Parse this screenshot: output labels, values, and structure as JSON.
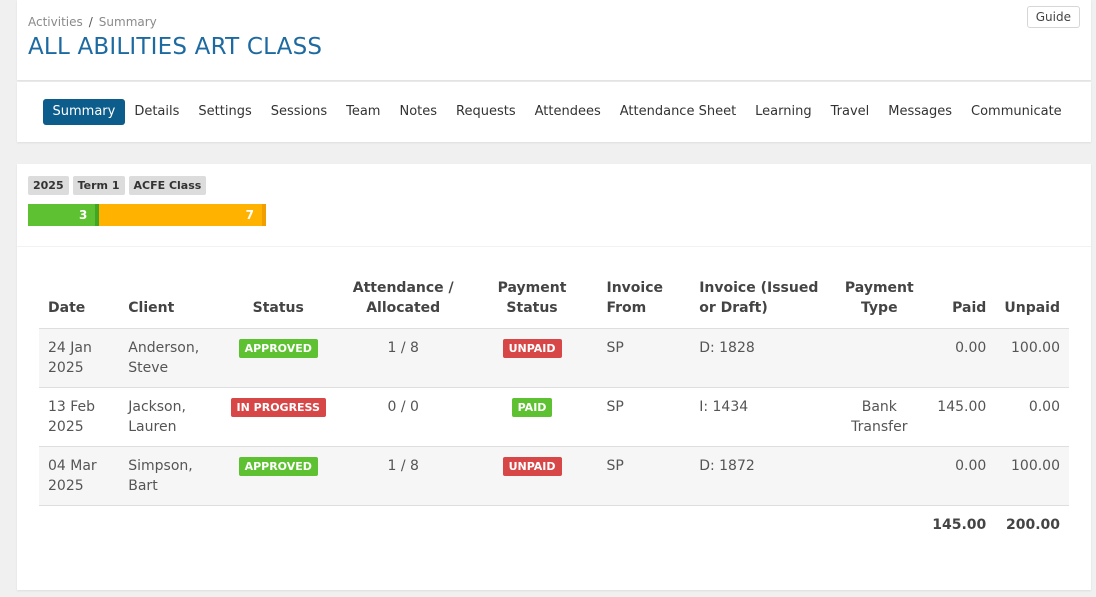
{
  "breadcrumb": {
    "parent": "Activities",
    "separator": "/",
    "current": "Summary"
  },
  "title": "ALL ABILITIES ART CLASS",
  "guide_label": "Guide",
  "tabs": [
    "Summary",
    "Details",
    "Settings",
    "Sessions",
    "Team",
    "Notes",
    "Requests",
    "Attendees",
    "Attendance Sheet",
    "Learning",
    "Travel",
    "Messages",
    "Communicate"
  ],
  "active_tab": "Summary",
  "chips": [
    "2025",
    "Term 1",
    "ACFE Class"
  ],
  "progress": {
    "approved": 3,
    "in_progress": 7
  },
  "colors": {
    "accent": "#0c5c8c",
    "title": "#1d6aa1",
    "green": "#5ec132",
    "orange": "#ffb300",
    "red": "#d84747"
  },
  "table": {
    "headers": {
      "date": "Date",
      "client": "Client",
      "status": "Status",
      "attendance": "Attendance / Allocated",
      "payment_status": "Payment Status",
      "invoice_from": "Invoice From",
      "invoice": "Invoice (Issued or Draft)",
      "payment_type": "Payment Type",
      "paid": "Paid",
      "unpaid": "Unpaid"
    },
    "rows": [
      {
        "date": "24 Jan 2025",
        "client": "Anderson, Steve",
        "status": "APPROVED",
        "attendance": "1 / 8",
        "payment_status": "UNPAID",
        "invoice_from": "SP",
        "invoice": "D: 1828",
        "payment_type": "",
        "paid": "0.00",
        "unpaid": "100.00"
      },
      {
        "date": "13 Feb 2025",
        "client": "Jackson, Lauren",
        "status": "IN PROGRESS",
        "attendance": "0 / 0",
        "payment_status": "PAID",
        "invoice_from": "SP",
        "invoice": "I: 1434",
        "payment_type": "Bank Transfer",
        "paid": "145.00",
        "unpaid": "0.00"
      },
      {
        "date": "04 Mar 2025",
        "client": "Simpson, Bart",
        "status": "APPROVED",
        "attendance": "1 / 8",
        "payment_status": "UNPAID",
        "invoice_from": "SP",
        "invoice": "D: 1872",
        "payment_type": "",
        "paid": "0.00",
        "unpaid": "100.00"
      }
    ],
    "totals": {
      "paid": "145.00",
      "unpaid": "200.00"
    }
  }
}
